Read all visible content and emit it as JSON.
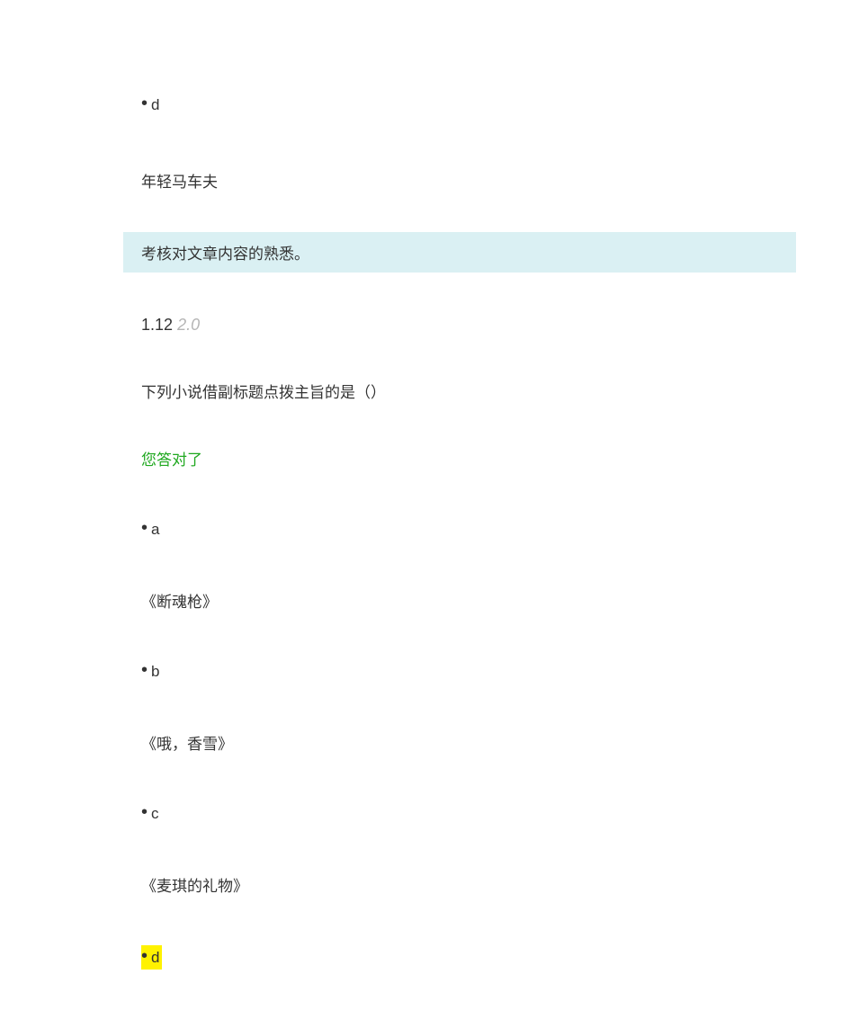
{
  "prevQuestion": {
    "optionD": {
      "letter": "d",
      "text": "年轻马车夫"
    },
    "assessment": "考核对文章内容的熟悉。"
  },
  "question": {
    "number": "1.12",
    "score": "2.0",
    "text": "下列小说借副标题点拨主旨的是（）",
    "result": "您答对了",
    "options": {
      "a": {
        "letter": "a",
        "text": "《断魂枪》"
      },
      "b": {
        "letter": "b",
        "text": "《哦，香雪》"
      },
      "c": {
        "letter": "c",
        "text": "《麦琪的礼物》"
      },
      "d": {
        "letter": "d"
      }
    }
  }
}
